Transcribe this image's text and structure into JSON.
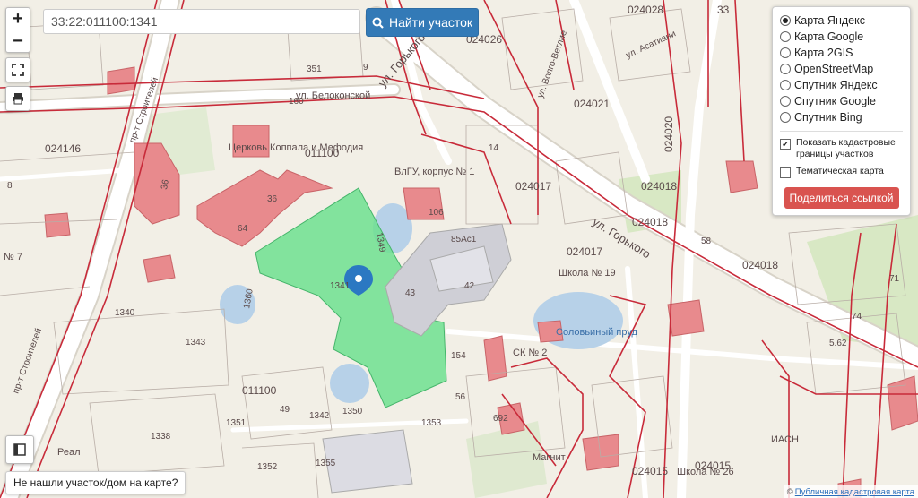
{
  "search": {
    "value": "33:22:011100:1341",
    "button_label": "Найти участок"
  },
  "zoom": {
    "in_label": "+",
    "out_label": "−"
  },
  "layers": {
    "options": [
      "Карта Яндекс",
      "Карта Google",
      "Карта 2GIS",
      "OpenStreetMap",
      "Спутник Яндекс",
      "Спутник Google",
      "Спутник Bing"
    ],
    "selected_index": 0,
    "cadastral_label": "Показать кадастровые границы участков",
    "cadastral_checked": true,
    "thematic_label": "Тематическая карта",
    "thematic_checked": false,
    "share_label": "Поделиться ссылкой"
  },
  "not_found_label": "Не нашли участок/дом на карте?",
  "attribution": {
    "prefix": "©",
    "link": "Публичная кадастровая карта"
  },
  "map": {
    "streets": [
      "ул. Горького",
      "ул. Горького",
      "ул. Белоконской",
      "ул. Асатиани",
      "ул. Волго-Ветлие",
      "пр-т Строителей",
      "пр-т Строителей"
    ],
    "districts": [
      "024028",
      "024026",
      "024146",
      "024021",
      "024020",
      "024017",
      "024018",
      "024018",
      "024017",
      "024018",
      "011100",
      "011100",
      "024015",
      "024015",
      "33"
    ],
    "numbers": [
      "1341",
      "1340",
      "1343",
      "1360",
      "1349",
      "1351",
      "1342",
      "1350",
      "1353",
      "1338",
      "1352",
      "1355",
      "56",
      "154",
      "692",
      "43",
      "42",
      "85Ас1",
      "106",
      "64",
      "36",
      "36",
      "49",
      "351",
      "160",
      "9",
      "8",
      "14",
      "58",
      "71",
      "74",
      "5.62"
    ],
    "places": [
      "Церковь Коппала и Мефодия",
      "ВлГУ, корпус № 1",
      "Соловьиный пруд",
      "СК № 2",
      "Школа № 19",
      "Школа № 26",
      "Магнит",
      "ИАСН",
      "Реал",
      "№ 7"
    ],
    "marker_label": "1341"
  }
}
